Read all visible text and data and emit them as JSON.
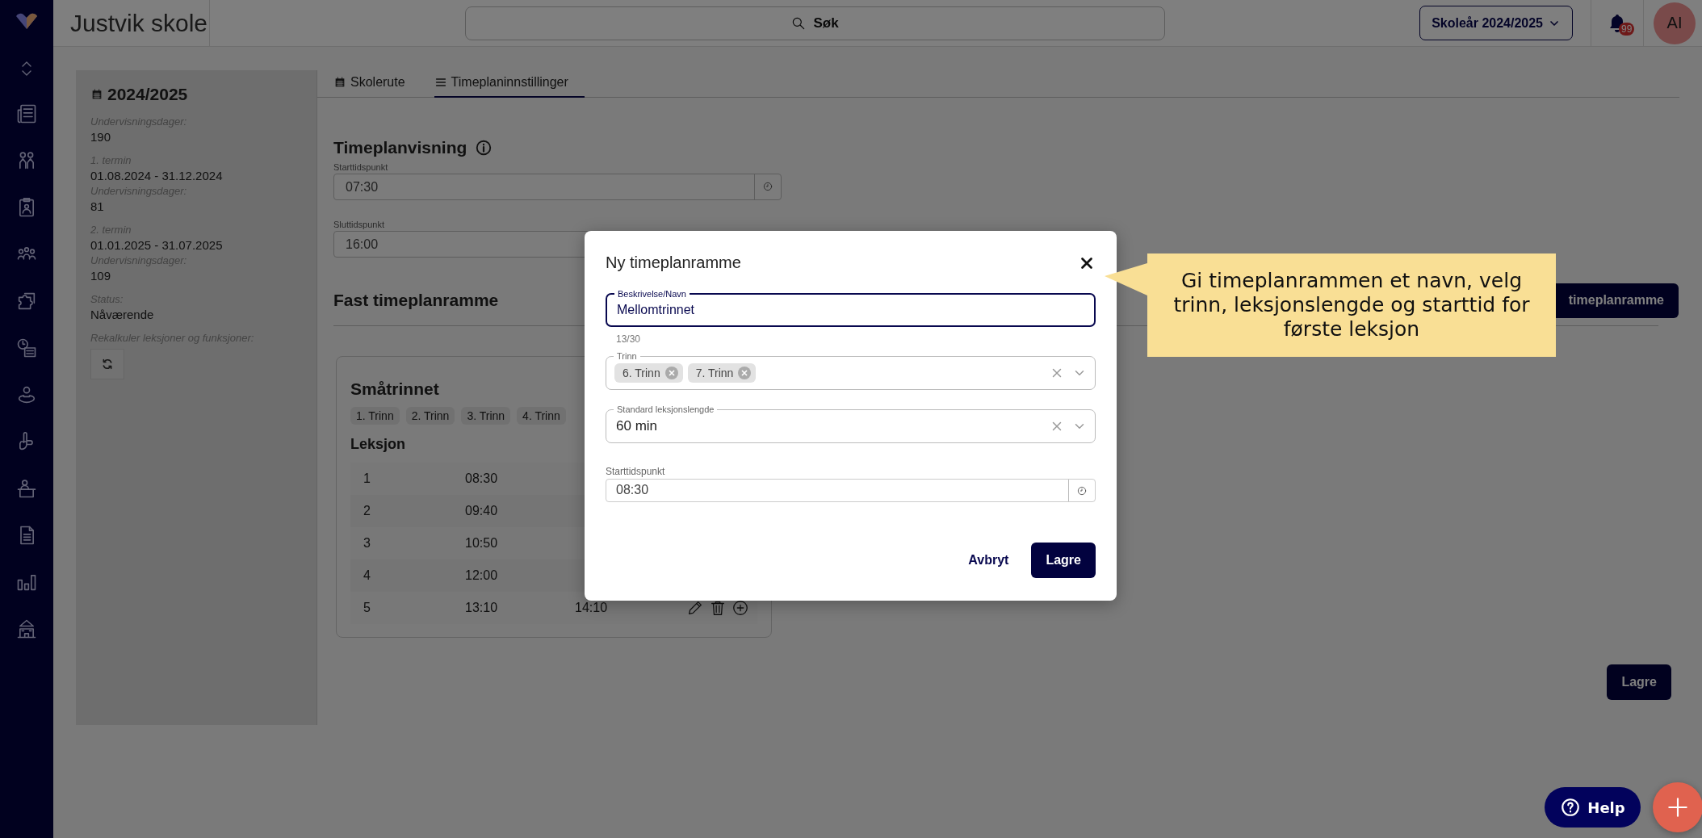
{
  "app": {
    "school_name": "Justvik skole"
  },
  "header": {
    "search_label": "Søk",
    "year_selector": "Skoleår 2024/2025",
    "notification_count": "99",
    "avatar_initials": "AI"
  },
  "year_panel": {
    "title": "2024/2025",
    "groups": [
      [
        {
          "label": "Undervisningsdager:",
          "value": "190"
        }
      ],
      [
        {
          "label": "1. termin",
          "value": "01.08.2024 - 31.12.2024"
        },
        {
          "label": "Undervisningsdager:",
          "value": "81"
        }
      ],
      [
        {
          "label": "2. termin",
          "value": "01.01.2025 - 31.07.2025"
        },
        {
          "label": "Undervisningsdager:",
          "value": "109"
        }
      ],
      [
        {
          "label": "Status:",
          "value": "Nåværende"
        }
      ]
    ],
    "recalc_label": "Rekalkuler leksjoner og funksjoner:"
  },
  "tabs": [
    {
      "label": "Skolerute",
      "kind": "calendar",
      "selected": false
    },
    {
      "label": "Timeplaninnstillinger",
      "kind": "list",
      "selected": true
    }
  ],
  "schedule_view": {
    "title": "Timeplanvisning",
    "start": {
      "label": "Starttidspunkt",
      "value": "07:30"
    },
    "end": {
      "label": "Sluttidspunkt",
      "value": "16:00"
    }
  },
  "fixed_frame": {
    "title": "Fast timeplanramme",
    "new_button": "timeplanramme",
    "cards": [
      {
        "title": "Småtrinnet",
        "grades": [
          "1. Trinn",
          "2. Trinn",
          "3. Trinn",
          "4. Trinn"
        ],
        "lessons_heading": "Leksjon",
        "lessons": [
          {
            "number": "1",
            "start": "08:30"
          },
          {
            "number": "2",
            "start": "09:40"
          },
          {
            "number": "3",
            "start": "10:50"
          },
          {
            "number": "4",
            "start": "12:00"
          },
          {
            "number": "5",
            "start": "13:10",
            "end": "14:10"
          }
        ]
      }
    ]
  },
  "save_button": "Lagre",
  "modal": {
    "title": "Ny timeplanramme",
    "name_field": {
      "label": "Beskrivelse/Navn",
      "value": "Mellomtrinnet",
      "counter": "13/30"
    },
    "grade_field": {
      "label": "Trinn",
      "chips": [
        "6. Trinn",
        "7. Trinn"
      ]
    },
    "length_field": {
      "label": "Standard leksjonslengde",
      "value": "60 min"
    },
    "start_field": {
      "label": "Starttidspunkt",
      "value": "08:30"
    },
    "cancel": "Avbryt",
    "save": "Lagre"
  },
  "callout": {
    "text": "Gi timeplanrammen et navn, velg trinn, leksjonslengde og starttid for første leksjon"
  },
  "help_button": "Help"
}
